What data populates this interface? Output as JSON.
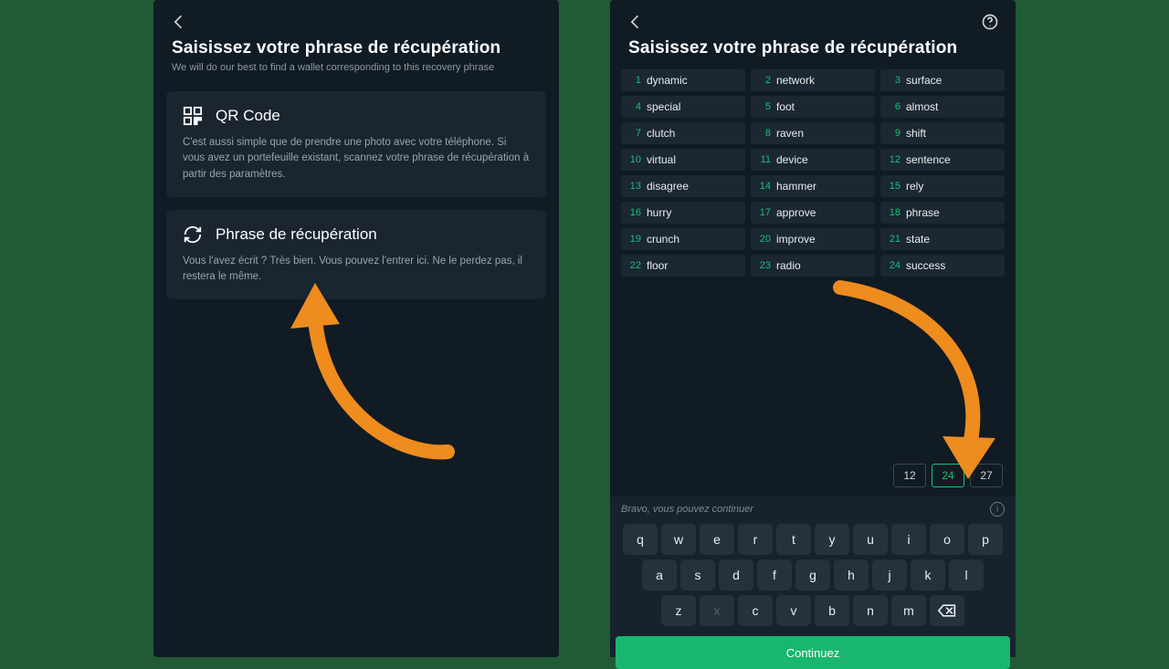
{
  "left": {
    "title": "Saisissez votre phrase de récupération",
    "subtitle": "We will do our best to find a wallet corresponding to this recovery phrase",
    "qr": {
      "label": "QR Code",
      "desc": "C'est aussi simple que de prendre une photo avec votre téléphone. Si vous avez un portefeuille existant, scannez votre phrase de récupération à partir des paramètres."
    },
    "phrase": {
      "label": "Phrase de récupération",
      "desc": "Vous l'avez écrit ? Très bien. Vous pouvez l'entrer ici. Ne le perdez pas, il restera le même."
    }
  },
  "right": {
    "title": "Saisissez votre phrase de récupération",
    "words": [
      "dynamic",
      "network",
      "surface",
      "special",
      "foot",
      "almost",
      "clutch",
      "raven",
      "shift",
      "virtual",
      "device",
      "sentence",
      "disagree",
      "hammer",
      "rely",
      "hurry",
      "approve",
      "phrase",
      "crunch",
      "improve",
      "state",
      "floor",
      "radio",
      "success"
    ],
    "lenOptions": [
      "12",
      "24",
      "27"
    ],
    "lenActive": "24",
    "hint": "Bravo, vous pouvez continuer",
    "continueLabel": "Continuez",
    "rows": [
      [
        "q",
        "w",
        "e",
        "r",
        "t",
        "y",
        "u",
        "i",
        "o",
        "p"
      ],
      [
        "a",
        "s",
        "d",
        "f",
        "g",
        "h",
        "j",
        "k",
        "l"
      ],
      [
        "z",
        "x",
        "c",
        "v",
        "b",
        "n",
        "m"
      ]
    ]
  }
}
